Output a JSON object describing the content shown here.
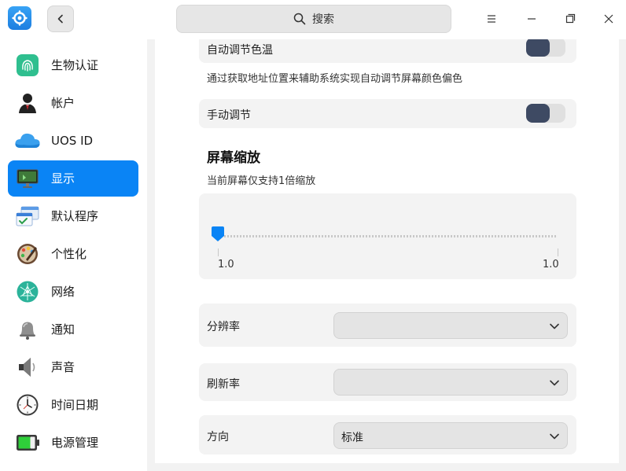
{
  "titlebar": {
    "search_placeholder": "搜索"
  },
  "sidebar": {
    "items": [
      {
        "label": "生物认证",
        "icon": "fingerprint-icon",
        "active": false
      },
      {
        "label": "帐户",
        "icon": "account-icon",
        "active": false
      },
      {
        "label": "UOS ID",
        "icon": "cloud-icon",
        "active": false
      },
      {
        "label": "显示",
        "icon": "display-icon",
        "active": true
      },
      {
        "label": "默认程序",
        "icon": "default-apps-icon",
        "active": false
      },
      {
        "label": "个性化",
        "icon": "palette-icon",
        "active": false
      },
      {
        "label": "网络",
        "icon": "network-icon",
        "active": false
      },
      {
        "label": "通知",
        "icon": "bell-icon",
        "active": false
      },
      {
        "label": "声音",
        "icon": "speaker-icon",
        "active": false
      },
      {
        "label": "时间日期",
        "icon": "clock-icon",
        "active": false
      },
      {
        "label": "电源管理",
        "icon": "battery-icon",
        "active": false
      }
    ]
  },
  "main": {
    "auto_color_temp": {
      "label": "自动调节色温",
      "enabled": true
    },
    "auto_color_temp_desc": "通过获取地址位置来辅助系统实现自动调节屏幕颜色偏色",
    "manual_adjust": {
      "label": "手动调节",
      "enabled": true
    },
    "scaling": {
      "title": "屏幕缩放",
      "desc": "当前屏幕仅支持1倍缩放",
      "min_label": "1.0",
      "max_label": "1.0",
      "value": 1.0
    },
    "resolution": {
      "label": "分辨率",
      "value": ""
    },
    "refresh_rate": {
      "label": "刷新率",
      "value": ""
    },
    "orientation": {
      "label": "方向",
      "value": "标准"
    }
  },
  "colors": {
    "accent": "#0a84f5",
    "toggle_on": "#3e4a63"
  }
}
